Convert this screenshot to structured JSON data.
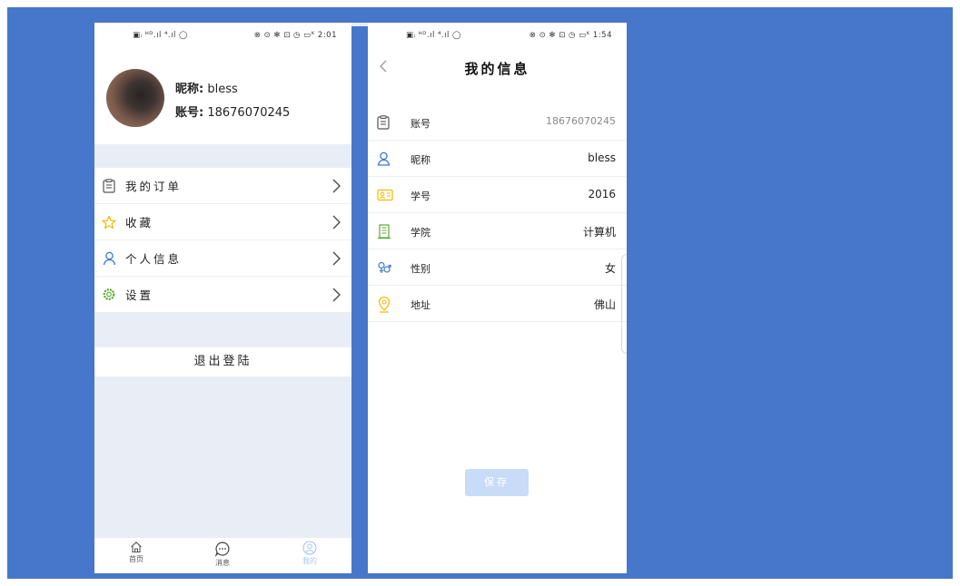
{
  "phone1": {
    "status": {
      "left": "▣ᵢ ᴴᴰ.ıl ⁴.ıl ◯",
      "right": "⊗ ⊙ ✻ ⊡ ◷ ▭ᴷ 2:01"
    },
    "profile": {
      "nickname_label": "昵称:",
      "nickname_value": "bless",
      "account_label": "账号:",
      "account_value": "18676070245"
    },
    "menu": [
      {
        "label": "我的订单",
        "icon": "clipboard-icon"
      },
      {
        "label": "收藏",
        "icon": "star-icon"
      },
      {
        "label": "个人信息",
        "icon": "person-icon"
      },
      {
        "label": "设置",
        "icon": "gear-icon"
      }
    ],
    "logout_label": "退出登陆",
    "tabs": [
      {
        "label": "首页",
        "icon": "home-icon"
      },
      {
        "label": "消息",
        "icon": "message-icon"
      },
      {
        "label": "我的",
        "icon": "profile-icon"
      }
    ]
  },
  "phone2": {
    "status": {
      "left": "▣ᵢ ᴴᴰ.ıl ⁴.ıl ◯",
      "right": "⊗ ⊙ ✻ ⊡ ◷ ▭ᴷ 1:54"
    },
    "title": "我的信息",
    "rows": [
      {
        "key": "账号",
        "value": "18676070245",
        "icon": "clipboard-icon"
      },
      {
        "key": "昵称",
        "value": "bless",
        "icon": "person-icon"
      },
      {
        "key": "学号",
        "value": "2016",
        "icon": "id-card-icon"
      },
      {
        "key": "学院",
        "value": "计算机",
        "icon": "building-icon"
      },
      {
        "key": "性别",
        "value": "女",
        "icon": "gender-icon"
      },
      {
        "key": "地址",
        "value": "佛山",
        "icon": "location-icon"
      }
    ],
    "save_label": "保存"
  },
  "colors": {
    "background": "#4677cb",
    "section_gray": "#e9eef6",
    "accent_blue": "#3d79d6",
    "accent_yellow": "#f5b800",
    "accent_green": "#5aa832",
    "save_button": "#c9dcf7",
    "tab_active": "#a9c4f0"
  }
}
